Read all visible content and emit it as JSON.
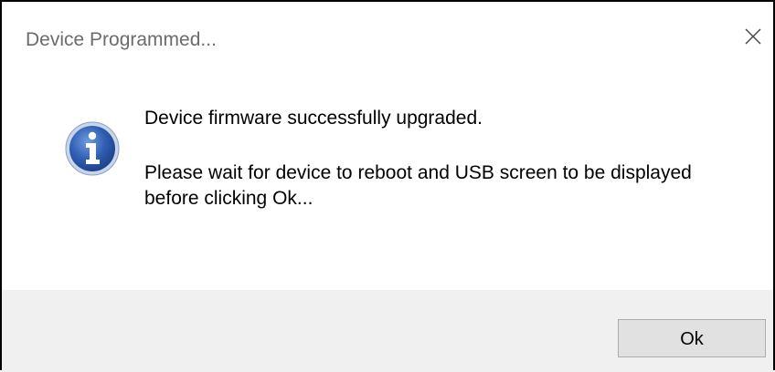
{
  "dialog": {
    "title": "Device Programmed...",
    "message_line1": "Device firmware successfully upgraded.",
    "message_line2": "Please wait for device to reboot and USB screen to be displayed before clicking Ok...",
    "ok_label": "Ok",
    "icon": "info-icon",
    "close_icon": "close-icon"
  },
  "colors": {
    "title_text": "#6b6b6b",
    "footer_bg": "#f0f0f0",
    "button_bg": "#e1e1e1",
    "button_border": "#adadad",
    "info_blue": "#2f5fb3"
  }
}
